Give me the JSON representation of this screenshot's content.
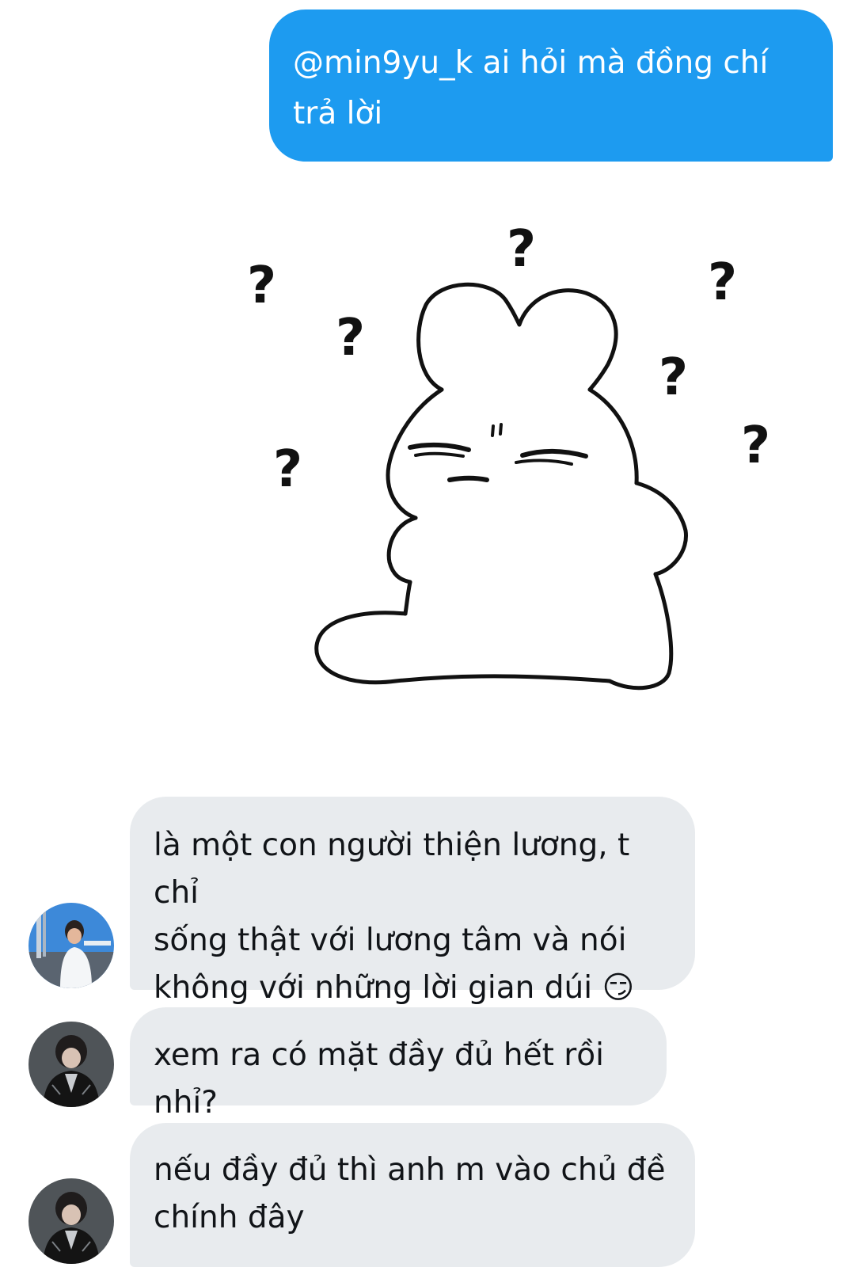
{
  "colors": {
    "outgoing_bubble": "#1d9bf0",
    "incoming_bubble": "#e8ebee",
    "text_dark": "#111418",
    "text_light": "#ffffff"
  },
  "outgoing": {
    "text": "@min9yu_k ai hỏi mà đồng chí\ntrả lời"
  },
  "sticker": {
    "icon": "confused-bunny-sticker"
  },
  "incoming": [
    {
      "avatar": "avatar-photo-blue-sky",
      "text": "là một con người thiện lương, t chỉ\nsống thật với lương tâm và nói\nkhông với những lời gian dúi 😏"
    },
    {
      "avatar": "avatar-photo-black-jacket",
      "text": "xem ra có mặt đầy đủ hết rồi nhỉ?"
    },
    {
      "avatar": "avatar-photo-black-jacket",
      "text": "nếu đầy đủ thì anh m vào chủ đề\nchính đây"
    }
  ]
}
